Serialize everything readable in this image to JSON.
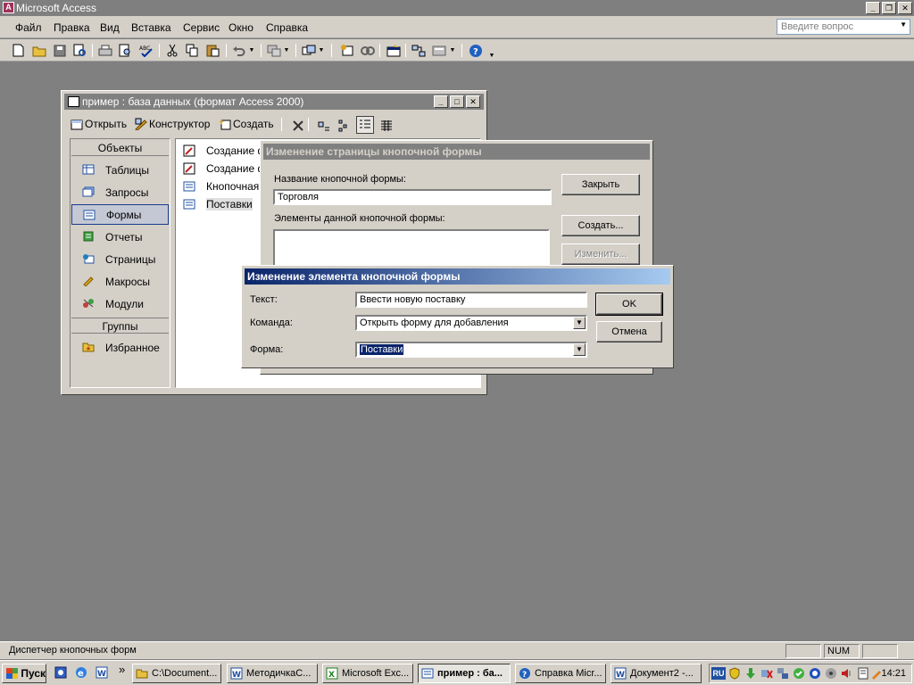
{
  "app": {
    "title": "Microsoft Access",
    "icon_letter": "A"
  },
  "menubar": {
    "items": [
      "Файл",
      "Правка",
      "Вид",
      "Вставка",
      "Сервис",
      "Окно",
      "Справка"
    ],
    "help_placeholder": "Введите вопрос"
  },
  "db_window": {
    "title": "пример : база данных (формат Access 2000)",
    "toolbar": {
      "open": "Открыть",
      "design": "Конструктор",
      "create": "Создать"
    },
    "objects_header": "Объекты",
    "objects": [
      "Таблицы",
      "Запросы",
      "Формы",
      "Отчеты",
      "Страницы",
      "Макросы",
      "Модули"
    ],
    "selected_object": "Формы",
    "groups_header": "Группы",
    "groups": [
      "Избранное"
    ],
    "list": [
      "Создание ф",
      "Создание ф",
      "Кнопочная",
      "Поставки"
    ]
  },
  "switchboard_page": {
    "title": "Изменение страницы кнопочной формы",
    "name_label": "Название кнопочной формы:",
    "name_value": "Торговля",
    "items_label": "Элементы данной кнопочной формы:",
    "close_button": "Закрыть",
    "new_button": "Создать...",
    "edit_button": "Изменить..."
  },
  "switchboard_item": {
    "title": "Изменение элемента кнопочной формы",
    "text_label": "Текст:",
    "text_value": "Ввести новую поставку",
    "command_label": "Команда:",
    "command_value": "Открыть форму для добавления",
    "form_label": "Форма:",
    "form_value": "Поставки",
    "ok_button": "OK",
    "cancel_button": "Отмена"
  },
  "statusbar": {
    "text": "Диспетчер кнопочных форм",
    "num": "NUM"
  },
  "taskbar": {
    "start": "Пуск",
    "tasks": [
      "C:\\Document...",
      "МетодичкаС...",
      "Microsoft Exc...",
      "пример : ба...",
      "Справка Micr...",
      "Документ2 -..."
    ],
    "active_task": "пример : ба...",
    "lang": "RU",
    "clock": "14:21"
  }
}
